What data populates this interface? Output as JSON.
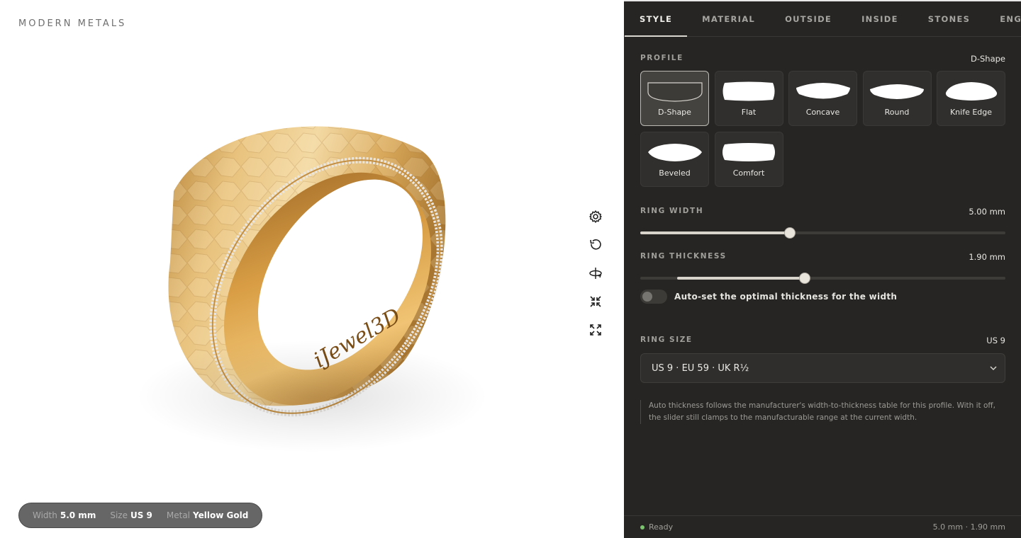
{
  "brand": "MODERN METALS",
  "tabs": [
    {
      "label": "STYLE",
      "active": true
    },
    {
      "label": "MATERIAL",
      "active": false
    },
    {
      "label": "OUTSIDE",
      "active": false
    },
    {
      "label": "INSIDE",
      "active": false
    },
    {
      "label": "STONES",
      "active": false
    },
    {
      "label": "ENGRAVE",
      "active": false
    }
  ],
  "profile": {
    "label": "PROFILE",
    "selected": "D-Shape",
    "options": [
      "D-Shape",
      "Flat",
      "Concave",
      "Round",
      "Knife Edge",
      "Beveled",
      "Comfort"
    ]
  },
  "ring_width": {
    "label": "RING WIDTH",
    "value_text": "5.00 mm",
    "fraction": 0.41
  },
  "ring_thickness": {
    "label": "RING THICKNESS",
    "value_text": "1.90 mm",
    "range_start_fraction": 0.1,
    "fraction": 0.45
  },
  "auto_thickness": {
    "label": "Auto-set the optimal thickness for the width",
    "on": false
  },
  "ring_size": {
    "label": "RING SIZE",
    "value": "US 9",
    "select_value": "US 9 · EU 59 · UK R½"
  },
  "note": "Auto thickness follows the manufacturer's width-to-thickness table for this profile. With it off, the slider still clamps to the manufacturable range at the current width.",
  "specs": {
    "width_key": "Width",
    "width_val": "5.0 mm",
    "size_key": "Size",
    "size_val": "US 9",
    "metal_key": "Metal",
    "metal_val": "Yellow Gold"
  },
  "tools": [
    "settings-icon",
    "reset-rotation-icon",
    "rotate-3d-icon",
    "collapse-icon",
    "fullscreen-icon"
  ],
  "footer": {
    "status": "Ready",
    "summary": "5.0 mm · 1.90 mm"
  },
  "engraving": "iJewel3D",
  "colors": {
    "panel_bg": "#262523",
    "gold": "#d9a84f",
    "status_ok": "#7bc36f"
  }
}
